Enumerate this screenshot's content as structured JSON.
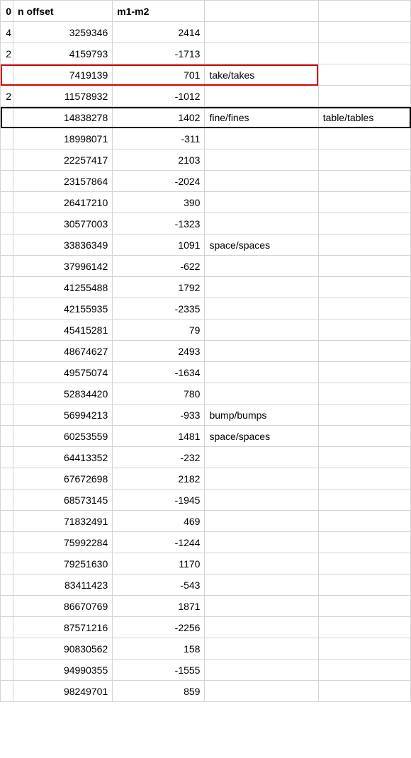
{
  "headers": {
    "col_a": "0",
    "col_b": "n offset",
    "col_c": "m1-m2",
    "col_d": "",
    "col_e": ""
  },
  "rows": [
    {
      "a": "4",
      "b": "3259346",
      "c": "2414",
      "d": "",
      "e": ""
    },
    {
      "a": "2",
      "b": "4159793",
      "c": "-1713",
      "d": "",
      "e": ""
    },
    {
      "a": "",
      "b": "7419139",
      "c": "701",
      "d": "take/takes",
      "e": ""
    },
    {
      "a": "2",
      "b": "11578932",
      "c": "-1012",
      "d": "",
      "e": ""
    },
    {
      "a": "",
      "b": "14838278",
      "c": "1402",
      "d": "fine/fines",
      "e": "table/tables"
    },
    {
      "a": "",
      "b": "18998071",
      "c": "-311",
      "d": "",
      "e": ""
    },
    {
      "a": "",
      "b": "22257417",
      "c": "2103",
      "d": "",
      "e": ""
    },
    {
      "a": "",
      "b": "23157864",
      "c": "-2024",
      "d": "",
      "e": ""
    },
    {
      "a": "",
      "b": "26417210",
      "c": "390",
      "d": "",
      "e": ""
    },
    {
      "a": "",
      "b": "30577003",
      "c": "-1323",
      "d": "",
      "e": ""
    },
    {
      "a": "",
      "b": "33836349",
      "c": "1091",
      "d": "space/spaces",
      "e": ""
    },
    {
      "a": "",
      "b": "37996142",
      "c": "-622",
      "d": "",
      "e": ""
    },
    {
      "a": "",
      "b": "41255488",
      "c": "1792",
      "d": "",
      "e": ""
    },
    {
      "a": "",
      "b": "42155935",
      "c": "-2335",
      "d": "",
      "e": ""
    },
    {
      "a": "",
      "b": "45415281",
      "c": "79",
      "d": "",
      "e": ""
    },
    {
      "a": "",
      "b": "48674627",
      "c": "2493",
      "d": "",
      "e": ""
    },
    {
      "a": "",
      "b": "49575074",
      "c": "-1634",
      "d": "",
      "e": ""
    },
    {
      "a": "",
      "b": "52834420",
      "c": "780",
      "d": "",
      "e": ""
    },
    {
      "a": "",
      "b": "56994213",
      "c": "-933",
      "d": "bump/bumps",
      "e": ""
    },
    {
      "a": "",
      "b": "60253559",
      "c": "1481",
      "d": "space/spaces",
      "e": ""
    },
    {
      "a": "",
      "b": "64413352",
      "c": "-232",
      "d": "",
      "e": ""
    },
    {
      "a": "",
      "b": "67672698",
      "c": "2182",
      "d": "",
      "e": ""
    },
    {
      "a": "",
      "b": "68573145",
      "c": "-1945",
      "d": "",
      "e": ""
    },
    {
      "a": "",
      "b": "71832491",
      "c": "469",
      "d": "",
      "e": ""
    },
    {
      "a": "",
      "b": "75992284",
      "c": "-1244",
      "d": "",
      "e": ""
    },
    {
      "a": "",
      "b": "79251630",
      "c": "1170",
      "d": "",
      "e": ""
    },
    {
      "a": "",
      "b": "83411423",
      "c": "-543",
      "d": "",
      "e": ""
    },
    {
      "a": "",
      "b": "86670769",
      "c": "1871",
      "d": "",
      "e": ""
    },
    {
      "a": "",
      "b": "87571216",
      "c": "-2256",
      "d": "",
      "e": ""
    },
    {
      "a": "",
      "b": "90830562",
      "c": "158",
      "d": "",
      "e": ""
    },
    {
      "a": "",
      "b": "94990355",
      "c": "-1555",
      "d": "",
      "e": ""
    },
    {
      "a": "",
      "b": "98249701",
      "c": "859",
      "d": "",
      "e": ""
    }
  ],
  "highlights": {
    "red_row_index": 2,
    "black_row_index": 4
  }
}
